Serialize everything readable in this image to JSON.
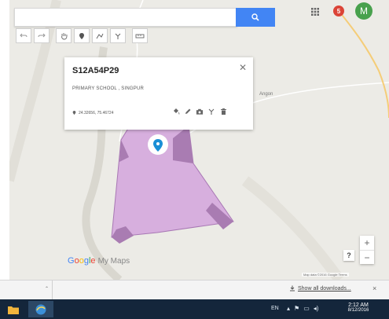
{
  "search": {
    "value": "",
    "placeholder": ""
  },
  "toolbar": {
    "tools": [
      "undo-icon",
      "redo-icon",
      "hand-icon",
      "marker-icon",
      "line-icon",
      "route-icon",
      "ruler-icon"
    ]
  },
  "header": {
    "apps_icon": "grid-icon",
    "notifications_count": "5",
    "avatar_letter": "M"
  },
  "card": {
    "title": "S12A54P29",
    "description": "PRIMARY SCHOOL , SINGPUR",
    "coordinates": "24.32656, 75.46724",
    "actions": [
      "paint-bucket-icon",
      "pencil-icon",
      "camera-icon",
      "directions-icon",
      "trash-icon"
    ]
  },
  "map": {
    "place_label": "Angon",
    "logo_google": "Google",
    "logo_mymaps": "My Maps",
    "help_label": "?",
    "zoom_in": "+",
    "zoom_out": "−",
    "attribution": "Map data ©2016 Google   Terms",
    "colors": {
      "polygon_fill": "#d5a8dd",
      "polygon_stroke": "#a877b4",
      "corner_fill": "#a97cb2",
      "road": "#f5cd78"
    }
  },
  "downloads": {
    "show_all": "Show all downloads...",
    "close": "×"
  },
  "taskbar": {
    "language": "EN",
    "time": "2:12 AM",
    "date": "8/12/2016"
  }
}
